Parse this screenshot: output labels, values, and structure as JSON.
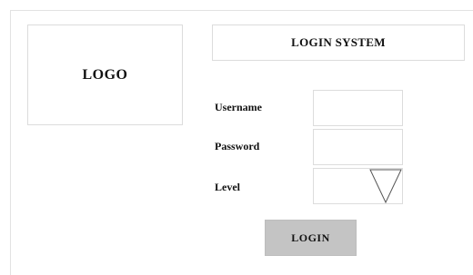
{
  "logo": {
    "text": "LOGO"
  },
  "header": {
    "title": "LOGIN SYSTEM"
  },
  "form": {
    "username": {
      "label": "Username",
      "value": "",
      "placeholder": ""
    },
    "password": {
      "label": "Password",
      "value": "",
      "placeholder": ""
    },
    "level": {
      "label": "Level",
      "selected": ""
    }
  },
  "login_button": {
    "label": "LOGIN"
  },
  "icons": {
    "level_dropdown": "chevron-down-icon"
  },
  "colors": {
    "button_bg": "#c4c4c4",
    "border": "#dcdcdc"
  }
}
